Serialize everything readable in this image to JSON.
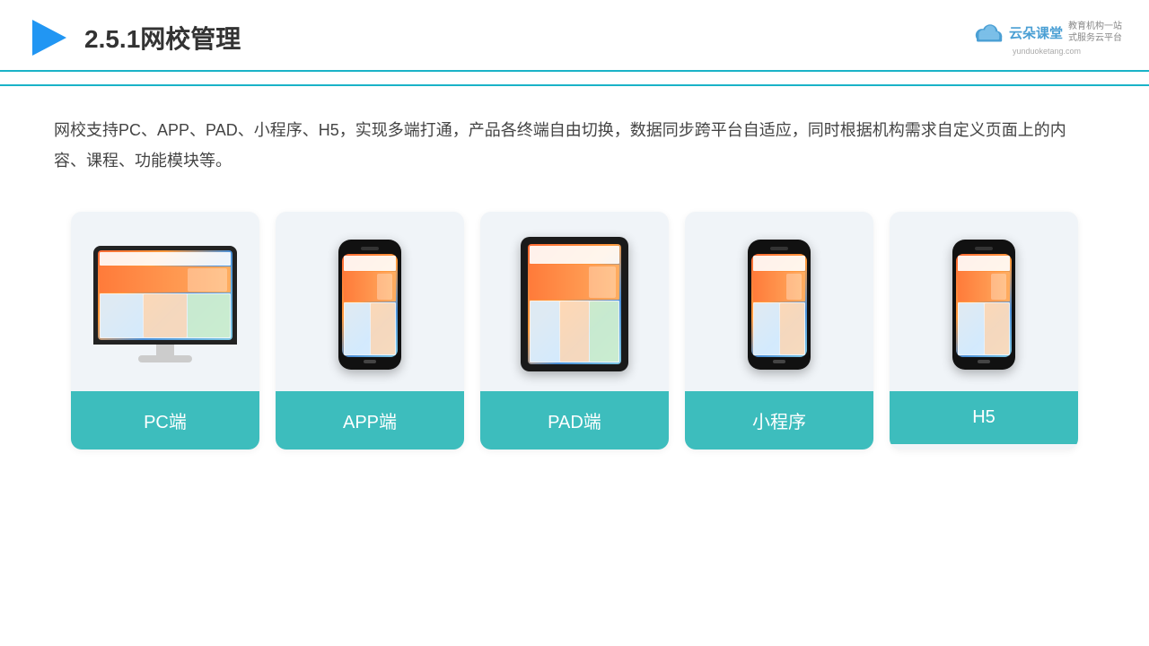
{
  "header": {
    "title": "2.5.1网校管理",
    "logo_name": "云朵课堂",
    "logo_url": "yunduoketang.com",
    "logo_subtitle_line1": "教育机构一站",
    "logo_subtitle_line2": "式服务云平台"
  },
  "description": {
    "text": "网校支持PC、APP、PAD、小程序、H5，实现多端打通，产品各终端自由切换，数据同步跨平台自适应，同时根据机构需求自定义页面上的内容、课程、功能模块等。"
  },
  "cards": [
    {
      "id": "pc",
      "label": "PC端"
    },
    {
      "id": "app",
      "label": "APP端"
    },
    {
      "id": "pad",
      "label": "PAD端"
    },
    {
      "id": "mini",
      "label": "小程序"
    },
    {
      "id": "h5",
      "label": "H5"
    }
  ],
  "colors": {
    "accent": "#3dbdbd",
    "header_line": "#1ab3c8",
    "bg": "#ffffff",
    "card_bg": "#edf2f7",
    "title_color": "#333333"
  }
}
